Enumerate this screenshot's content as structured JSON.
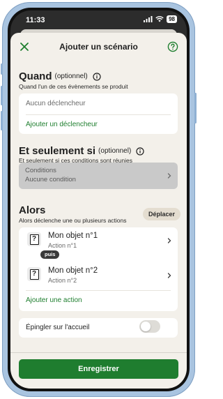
{
  "status_bar": {
    "time": "11:33",
    "battery": "98"
  },
  "header": {
    "title": "Ajouter un scénario"
  },
  "quand": {
    "title": "Quand",
    "optional": "(optionnel)",
    "subtitle": "Quand l'un de ces évènements se produit",
    "placeholder": "Aucun déclencheur",
    "add_link": "Ajouter un déclencheur"
  },
  "seulement": {
    "title": "Et seulement si",
    "optional": "(optionnel)",
    "subtitle": "Et seulement si ces conditions sont réunies",
    "conditions_label": "Conditions",
    "conditions_value": "Aucune condition"
  },
  "alors": {
    "title": "Alors",
    "subtitle": "Alors déclenche une ou plusieurs actions",
    "move_button": "Déplacer",
    "items": [
      {
        "title": "Mon objet n°1",
        "subtitle": "Action n°1",
        "icon": "question-mark-box-icon"
      },
      {
        "title": "Mon objet n°2",
        "subtitle": "Action n°2",
        "icon": "question-mark-box-icon"
      }
    ],
    "connector": "puis",
    "add_link": "Ajouter une action"
  },
  "pin": {
    "label": "Épingler sur l'accueil",
    "enabled": false
  },
  "save_button": "Enregistrer",
  "colors": {
    "accent_green": "#1f7d2f",
    "link_green": "#1e7e2e",
    "sheet_bg": "#f3f0ea",
    "disabled_card": "#c9c9c9"
  }
}
